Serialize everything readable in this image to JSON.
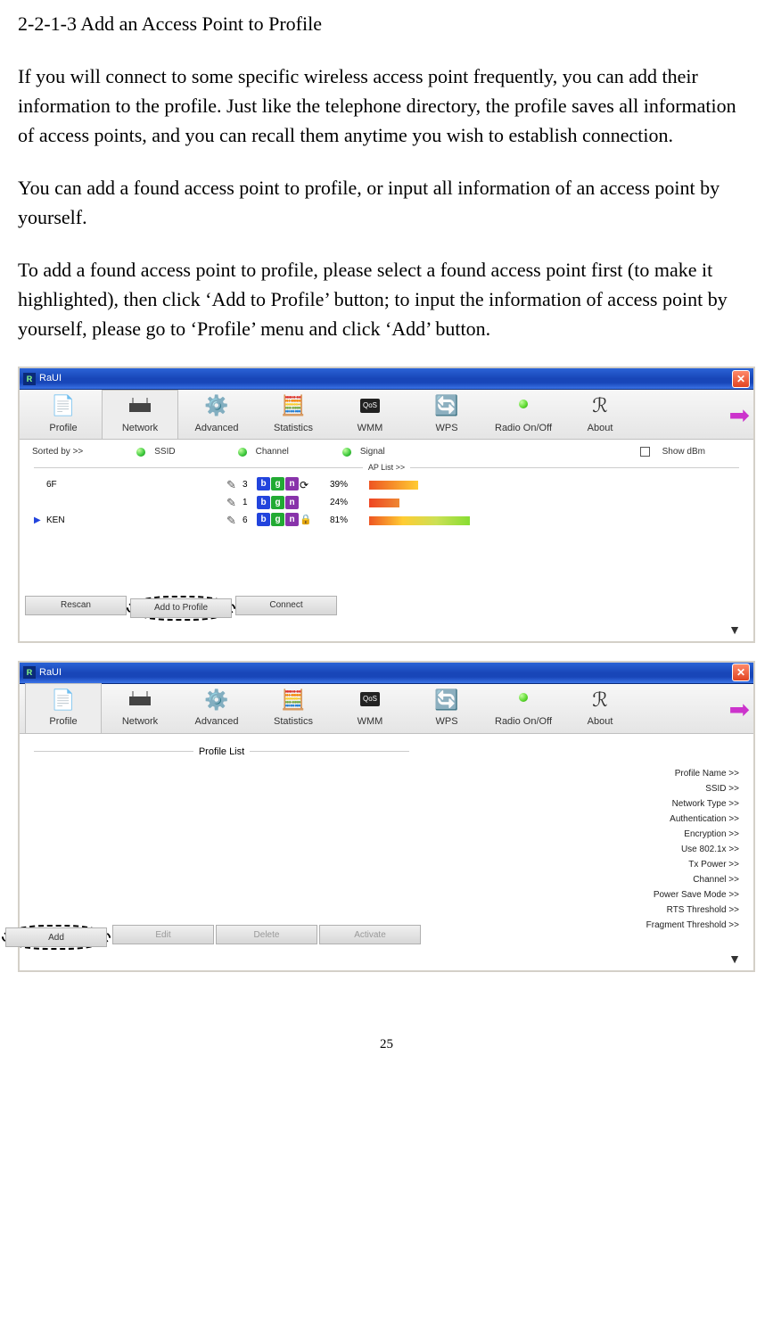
{
  "doc": {
    "heading": "2-2-1-3 Add an Access Point to Profile",
    "para1": "If you will connect to some specific wireless access point frequently, you can add their information to the profile. Just like the telephone directory, the profile saves all information of access points, and you can recall them anytime you wish to establish connection.",
    "para2": "You can add a found access point to profile, or input all information of an access point by yourself.",
    "para3": "To add a found access point to profile, please select a found access point first (to make it highlighted), then click ‘Add to Profile’ button; to input the information of access point by yourself, please go to ‘Profile’ menu and click ‘Add’ button.",
    "page_number": "25"
  },
  "panel1": {
    "title": "RaUI",
    "toolbar": {
      "profile": "Profile",
      "network": "Network",
      "advanced": "Advanced",
      "statistics": "Statistics",
      "wmm": "WMM",
      "wps": "WPS",
      "radio": "Radio On/Off",
      "about": "About"
    },
    "sort": {
      "label": "Sorted by >>",
      "ssid": "SSID",
      "channel": "Channel",
      "signal": "Signal",
      "show_dbm": "Show dBm"
    },
    "aplist_label": "AP List >>",
    "rows": [
      {
        "marker": "",
        "ssid": "6F",
        "channel": "3",
        "modes": [
          "b",
          "g",
          "n"
        ],
        "extra": "dir",
        "pct": "39%",
        "bar_pct": 39,
        "bar_cls": "grad-ry"
      },
      {
        "marker": "",
        "ssid": "",
        "channel": "1",
        "modes": [
          "b",
          "g",
          "n"
        ],
        "extra": "",
        "pct": "24%",
        "bar_pct": 24,
        "bar_cls": "grad-r"
      },
      {
        "marker": "▶",
        "ssid": "KEN",
        "channel": "6",
        "modes": [
          "b",
          "g",
          "n"
        ],
        "extra": "lock",
        "pct": "81%",
        "bar_pct": 81,
        "bar_cls": "grad-ryg"
      }
    ],
    "buttons": {
      "rescan": "Rescan",
      "add_to_profile": "Add to Profile",
      "connect": "Connect"
    }
  },
  "panel2": {
    "title": "RaUI",
    "toolbar": {
      "profile": "Profile",
      "network": "Network",
      "advanced": "Advanced",
      "statistics": "Statistics",
      "wmm": "WMM",
      "wps": "WPS",
      "radio": "Radio On/Off",
      "about": "About"
    },
    "profile_list_label": "Profile List",
    "details": {
      "profile_name": "Profile Name >>",
      "ssid": "SSID >>",
      "network_type": "Network Type >>",
      "authentication": "Authentication >>",
      "encryption": "Encryption >>",
      "use_8021x": "Use 802.1x >>",
      "tx_power": "Tx Power >>",
      "channel": "Channel >>",
      "psm": "Power Save Mode >>",
      "rts": "RTS Threshold >>",
      "frag": "Fragment Threshold >>"
    },
    "buttons": {
      "add": "Add",
      "edit": "Edit",
      "delete": "Delete",
      "activate": "Activate"
    }
  }
}
